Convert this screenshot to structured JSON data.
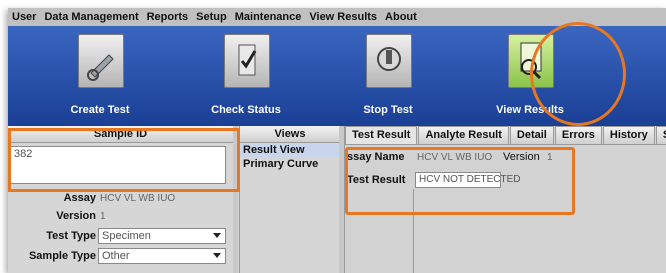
{
  "menu": [
    "User",
    "Data Management",
    "Reports",
    "Setup",
    "Maintenance",
    "View Results",
    "About"
  ],
  "toolbar": {
    "create_test": "Create Test",
    "check_status": "Check Status",
    "stop_test": "Stop Test",
    "view_results": "View Results"
  },
  "highlight_color": "#e87722",
  "sample": {
    "header": "Sample ID",
    "value": "382",
    "assay_label": "Assay",
    "assay_value": "HCV VL WB IUO",
    "version_label": "Version",
    "version_value": "1",
    "test_type_label": "Test Type",
    "test_type_value": "Specimen",
    "sample_type_label": "Sample Type",
    "sample_type_value": "Other"
  },
  "views": {
    "header": "Views",
    "items": [
      "Result View",
      "Primary Curve"
    ]
  },
  "tabs": [
    "Test Result",
    "Analyte Result",
    "Detail",
    "Errors",
    "History",
    "Sup"
  ],
  "result": {
    "assay_name_label": "ssay Name",
    "assay_name_value": "HCV VL WB IUO",
    "version_label": "Version",
    "version_value": "1",
    "test_result_label": "Test Result",
    "test_result_value": "HCV NOT DETECTED"
  }
}
